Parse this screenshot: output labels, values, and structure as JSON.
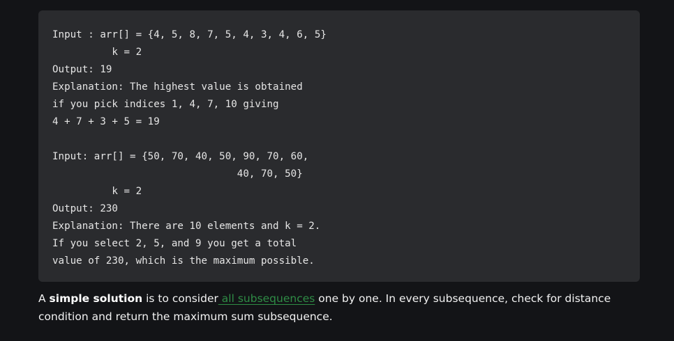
{
  "code_block": {
    "lines": [
      "Input : arr[] = {4, 5, 8, 7, 5, 4, 3, 4, 6, 5}",
      "          k = 2",
      "Output: 19",
      "Explanation: The highest value is obtained",
      "if you pick indices 1, 4, 7, 10 giving",
      "4 + 7 + 3 + 5 = 19",
      "",
      "Input: arr[] = {50, 70, 40, 50, 90, 70, 60,",
      "                               40, 70, 50}",
      "          k = 2",
      "Output: 230",
      "Explanation: There are 10 elements and k = 2.",
      "If you select 2, 5, and 9 you get a total",
      "value of 230, which is the maximum possible."
    ]
  },
  "paragraph": {
    "lead": "A ",
    "strong": "simple solution",
    "middle": " is to consider",
    "link_text": " all subsequences",
    "rest": " one by one. In every subsequence, check for distance condition and return the maximum sum subsequence."
  },
  "colors": {
    "page_background": "#131417",
    "code_background": "#2a2b2e",
    "link": "#2f8d46"
  }
}
